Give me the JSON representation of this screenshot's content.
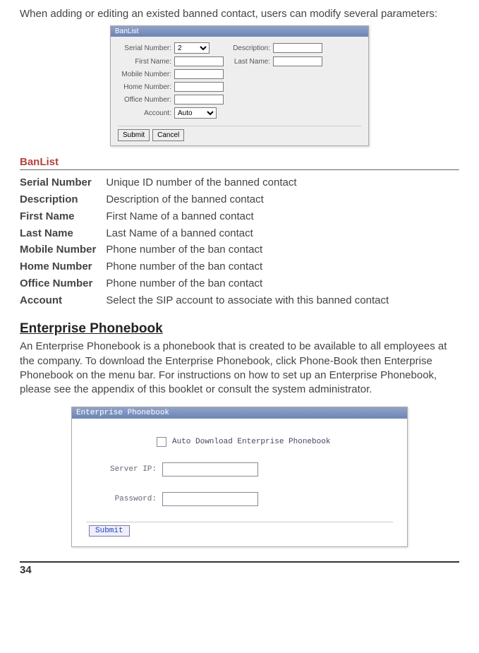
{
  "intro": "When adding or editing an existed banned contact, users can modify several parameters:",
  "banlist_fig": {
    "title": "BanList",
    "labels": {
      "serial": "Serial Number:",
      "description": "Description:",
      "first": "First Name:",
      "last": "Last Name:",
      "mobile": "Mobile Number:",
      "home": "Home Number:",
      "office": "Office Number:",
      "account": "Account:"
    },
    "serial_value": "2",
    "account_value": "Auto",
    "buttons": {
      "submit": "Submit",
      "cancel": "Cancel"
    }
  },
  "section_title": "BanList",
  "defs": [
    {
      "k": "Serial Number",
      "v": "Unique ID number of the banned contact"
    },
    {
      "k": "Description",
      "v": "Description of the banned contact"
    },
    {
      "k": "First Name",
      "v": "First Name of a banned contact"
    },
    {
      "k": "Last Name",
      "v": "Last Name of a banned contact"
    },
    {
      "k": "Mobile Number",
      "v": "Phone number of the ban contact"
    },
    {
      "k": "Home Number",
      "v": "Phone number of the ban contact"
    },
    {
      "k": "Office Number",
      "v": "Phone number of the ban contact"
    },
    {
      "k": "Account",
      "v": "Select the SIP account to associate with this banned contact"
    }
  ],
  "ep_heading": "Enterprise Phonebook",
  "ep_desc": "An Enterprise Phonebook is a phonebook that is created to be available to all employees at the company.  To download the Enterprise Phonebook, click Phone-Book then Enterprise Phonebook on the menu bar. For instructions on how to set up an Enterprise Phonebook, please see the appendix of this booklet or consult the system administrator.",
  "ep_fig": {
    "title": "Enterprise Phonebook",
    "checkbox_label": "Auto Download Enterprise Phonebook",
    "server_ip": "Server IP:",
    "password": "Password:",
    "submit": "Submit"
  },
  "page_number": "34"
}
